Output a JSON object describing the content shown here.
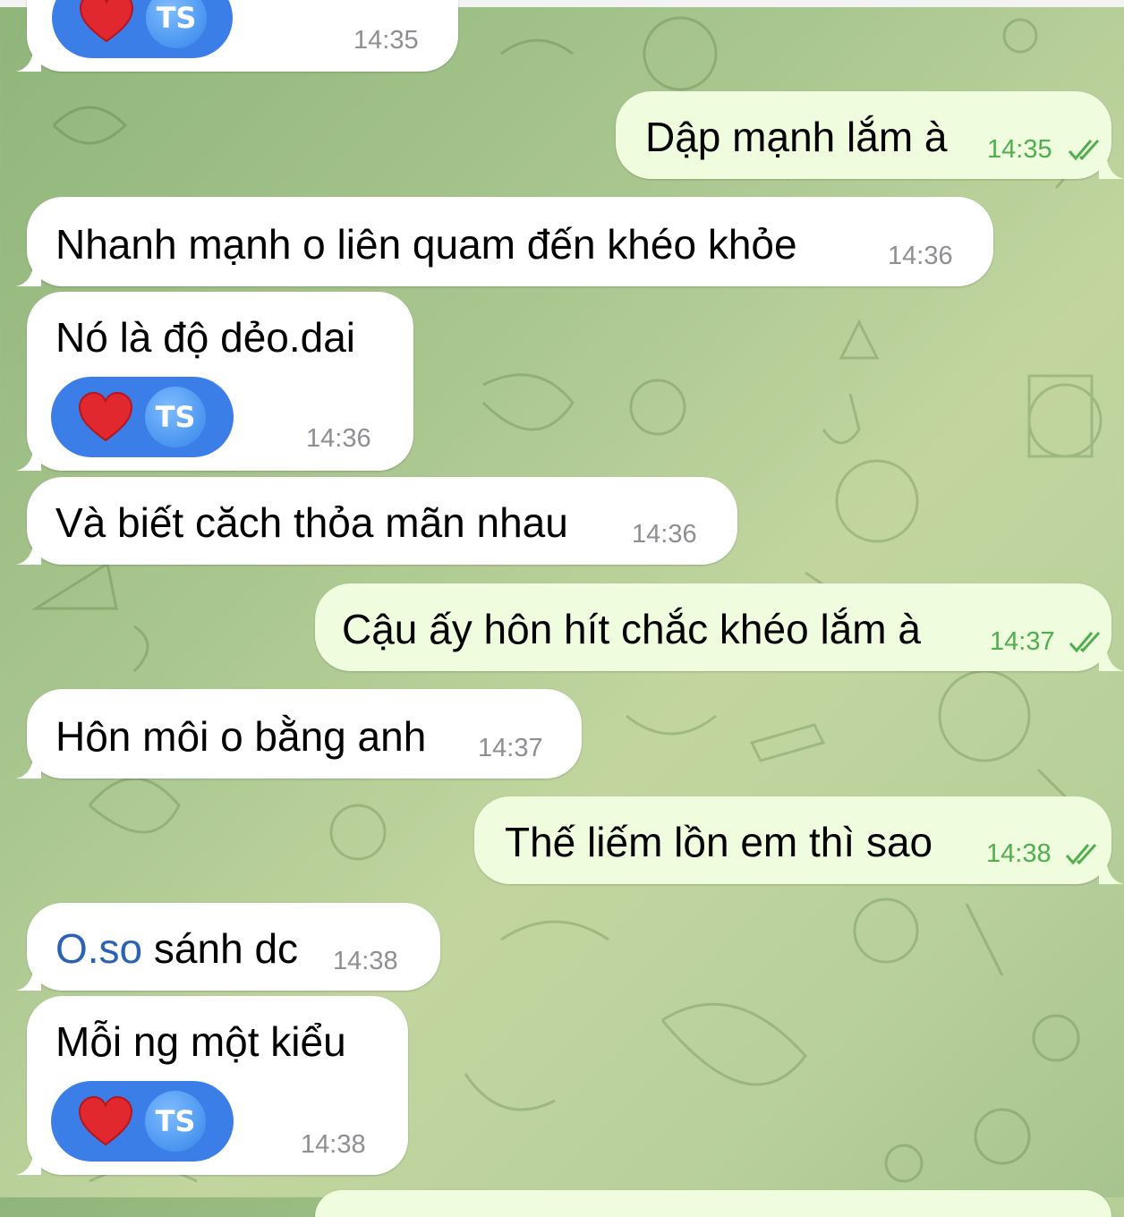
{
  "messages": [
    {
      "id": "m0",
      "side": "in",
      "text": "",
      "time": "14:35",
      "reaction": {
        "emoji": "heart",
        "initials": "TS"
      }
    },
    {
      "id": "m1",
      "side": "out",
      "text": "Dập mạnh lắm à",
      "time": "14:35",
      "read": true
    },
    {
      "id": "m2",
      "side": "in",
      "text": "Nhanh mạnh o liên quam đến khéo khỏe",
      "time": "14:36"
    },
    {
      "id": "m3",
      "side": "in",
      "text": "Nó là độ dẻo.dai",
      "time": "14:36",
      "reaction": {
        "emoji": "heart",
        "initials": "TS"
      }
    },
    {
      "id": "m4",
      "side": "in",
      "text": "Và biết căch thỏa mãn nhau",
      "time": "14:36"
    },
    {
      "id": "m5",
      "side": "out",
      "text": "Cậu ấy hôn hít chắc khéo lắm à",
      "time": "14:37",
      "read": true
    },
    {
      "id": "m6",
      "side": "in",
      "text": "Hôn môi o bằng anh",
      "time": "14:37"
    },
    {
      "id": "m7",
      "side": "out",
      "text": "Thế liếm lồn em thì sao",
      "time": "14:38",
      "read": true
    },
    {
      "id": "m8",
      "side": "in",
      "link_text": "O.so",
      "text": " sánh dc",
      "time": "14:38"
    },
    {
      "id": "m9",
      "side": "in",
      "text": "Mỗi ng một kiểu",
      "time": "14:38",
      "reaction": {
        "emoji": "heart",
        "initials": "TS"
      }
    }
  ],
  "colors": {
    "incoming_bubble": "#ffffff",
    "outgoing_bubble": "#effdde",
    "outgoing_time": "#4fae4e",
    "reaction_pill": "#3c7ee8",
    "link": "#2a63b5"
  }
}
